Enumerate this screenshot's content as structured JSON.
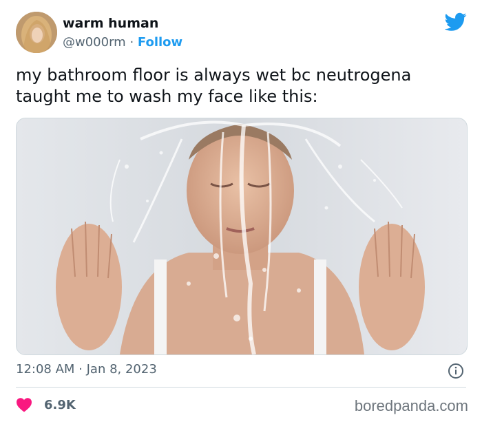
{
  "tweet": {
    "author_name": "warm human",
    "handle": "@w000rm",
    "separator": "·",
    "follow_label": "Follow",
    "text": "my bathroom floor is always wet bc neutrogena taught me to wash my face like this:",
    "timestamp": "12:08 AM · Jan 8, 2023",
    "likes": "6.9K"
  },
  "icons": {
    "brand": "twitter-bird-icon",
    "info": "info-icon",
    "like": "heart-icon"
  },
  "colors": {
    "accent": "#1d9bf0",
    "heart": "#f91880",
    "secondary_text": "#536471"
  },
  "watermark": "boredpanda.com"
}
